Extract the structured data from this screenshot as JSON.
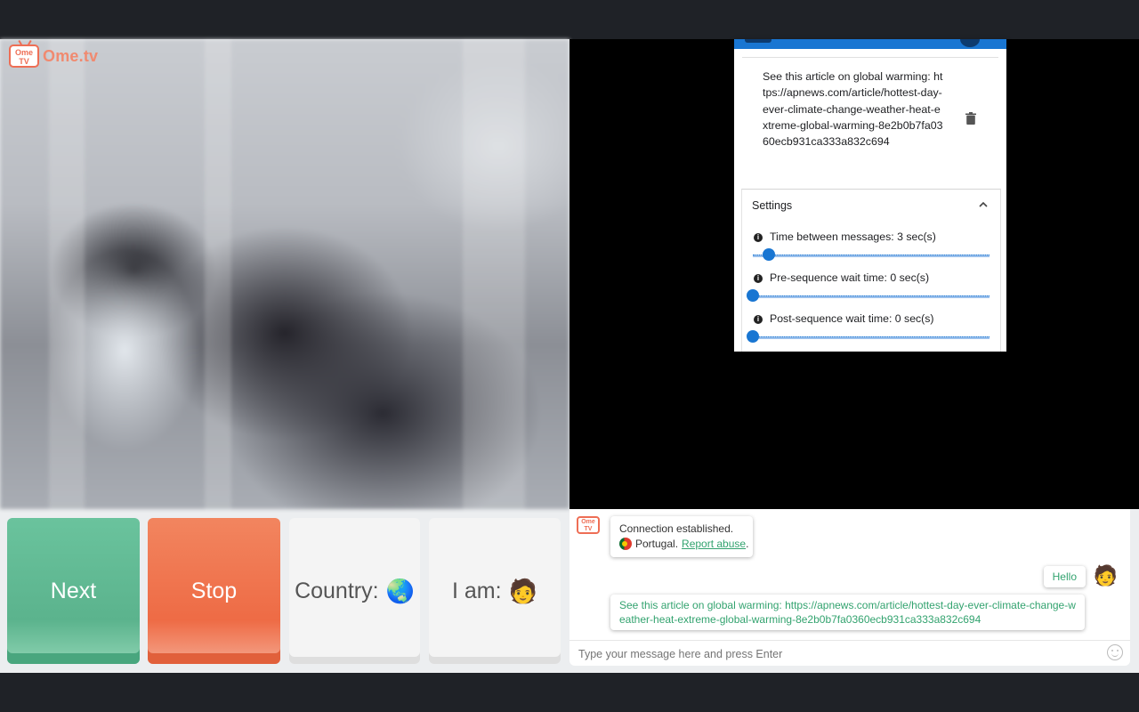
{
  "app": {
    "logo_badge": "Ome TV",
    "logo_text": "Ome.tv"
  },
  "popup": {
    "message": "See this article on global warming: https://apnews.com/article/hottest-day-ever-climate-change-weather-heat-extreme-global-warming-8e2b0b7fa0360ecb931ca333a832c694",
    "settings_title": "Settings",
    "settings": [
      {
        "label": "Time between messages: 3 sec(s)",
        "value_sec": 3
      },
      {
        "label": "Pre-sequence wait time: 0 sec(s)",
        "value_sec": 0
      },
      {
        "label": "Post-sequence wait time: 0 sec(s)",
        "value_sec": 0
      }
    ],
    "accent_color": "#1976d2"
  },
  "controls": {
    "next": "Next",
    "stop": "Stop",
    "country_label": "Country:",
    "country_emoji": "🌏",
    "iam_label": "I am:",
    "iam_emoji": "🧑"
  },
  "chat": {
    "logo_badge": "Ome TV",
    "system_line1": "Connection established.",
    "system_country": "Portugal.",
    "report_link": "Report abuse",
    "report_suffix": ".",
    "hello": "Hello",
    "me_emoji": "🧑",
    "link_message": "See this article on global warming: https://apnews.com/article/hottest-day-ever-climate-change-weather-heat-extreme-global-warming-8e2b0b7fa0360ecb931ca333a832c694",
    "input_placeholder": "Type your message here and press Enter"
  },
  "colors": {
    "next": "#5bb38d",
    "stop": "#ee6b45",
    "link_green": "#33a36f"
  }
}
